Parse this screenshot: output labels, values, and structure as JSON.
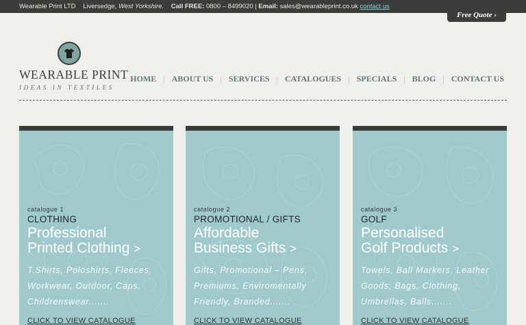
{
  "topbar": {
    "company": "Wearable Print LTD",
    "town": "Liversedge,",
    "region": "West Yorkshire.",
    "call_label": "Call FREE:",
    "phone": "0800 – 8499020",
    "email_label": "Email:",
    "email": "sales@wearableprint.co.uk",
    "contact_link": "contact us",
    "quote_button": "Free Quote",
    "quote_chevron": "›"
  },
  "logo": {
    "icon": "tshirt-icon",
    "name": "WEARABLE PRINT",
    "tagline": "IDEAS IN TEXTILES"
  },
  "nav": {
    "items": [
      "HOME",
      "ABOUT US",
      "SERVICES",
      "CATALOGUES",
      "SPECIALS",
      "BLOG",
      "CONTACT US"
    ],
    "separator": "|"
  },
  "cards": [
    {
      "number": "catalogue 1",
      "category": "CLOTHING",
      "headline_1": "Professional",
      "headline_2": "Printed Clothing",
      "arrow": ">",
      "desc_1": "T.Shirts, Poloshirts, Fleeces,",
      "desc_2": "Workwear, Outdoor, Caps,",
      "desc_3": "Childrenswear.......",
      "cta": "CLICK TO VIEW CATALOGUE"
    },
    {
      "number": "catalogue 2",
      "category": "PROMOTIONAL / GIFTS",
      "headline_1": "Affordable",
      "headline_2": "Business Gifts",
      "arrow": ">",
      "desc_1": "Gifts, Promotional – Pens,",
      "desc_2": "Premiums, Enviromentally",
      "desc_3": "Friendly, Branded.......",
      "cta": "CLICK TO VIEW CATALOGUE"
    },
    {
      "number": "catalogue 3",
      "category": "GOLF",
      "headline_1": "Personalised",
      "headline_2": "Golf Products",
      "arrow": ">",
      "desc_1": "Towels, Ball Markers, Leather",
      "desc_2": "Goods, Bags, Clothing,",
      "desc_3": "Umbrellas, Balls.......",
      "cta": "CLICK TO VIEW CATALOGUE"
    }
  ],
  "colors": {
    "dark": "#3b3d3a",
    "card": "#9fc9ca",
    "nav": "#5e7a78",
    "background": "#f1efea"
  }
}
